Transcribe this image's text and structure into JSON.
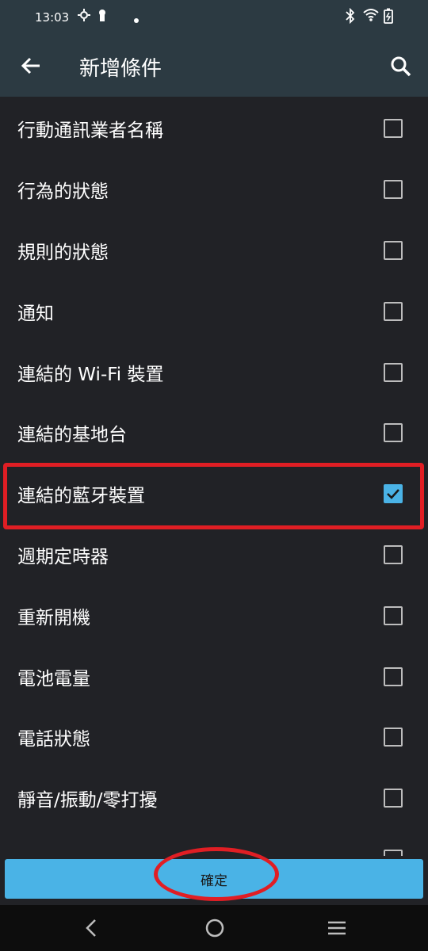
{
  "status": {
    "time": "13:03"
  },
  "appbar": {
    "title": "新增條件"
  },
  "conditions": [
    {
      "label": "行動通訊業者名稱",
      "checked": false
    },
    {
      "label": "行為的狀態",
      "checked": false
    },
    {
      "label": "規則的狀態",
      "checked": false
    },
    {
      "label": "通知",
      "checked": false
    },
    {
      "label": "連結的 Wi-Fi 裝置",
      "checked": false
    },
    {
      "label": "連結的基地台",
      "checked": false
    },
    {
      "label": "連結的藍牙裝置",
      "checked": true
    },
    {
      "label": "週期定時器",
      "checked": false
    },
    {
      "label": "重新開機",
      "checked": false
    },
    {
      "label": "電池電量",
      "checked": false
    },
    {
      "label": "電話狀態",
      "checked": false
    },
    {
      "label": "靜音/振動/零打擾",
      "checked": false
    },
    {
      "label": "",
      "checked": false
    }
  ],
  "confirm_label": "確定",
  "colors": {
    "accent": "#4ab3e6",
    "annotation": "#e01e24",
    "header": "#2c3a42",
    "background": "#212226"
  }
}
